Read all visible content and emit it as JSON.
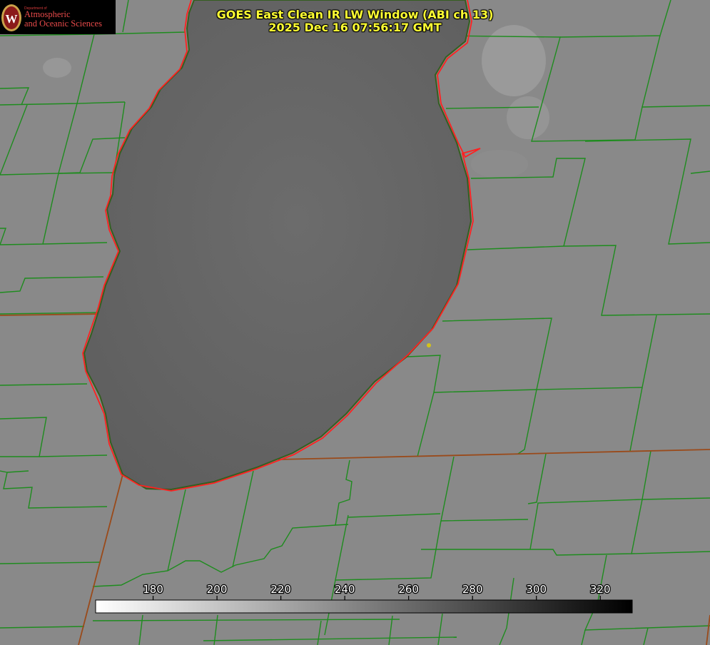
{
  "title": {
    "line1": "GOES East Clean IR LW Window (ABI ch 13)",
    "line2": "2025 Dec 16 07:56:17 GMT"
  },
  "logo": {
    "dept": "Department of",
    "line1": "Atmospheric",
    "line2": "and Oceanic Sciences",
    "emblem_letter": "W",
    "emblem_color": "#8b1a1a"
  },
  "colorbar": {
    "ticks": [
      {
        "label": "180",
        "value": 180
      },
      {
        "label": "200",
        "value": 200
      },
      {
        "label": "220",
        "value": 220
      },
      {
        "label": "240",
        "value": 240
      },
      {
        "label": "260",
        "value": 260
      },
      {
        "label": "280",
        "value": 280
      },
      {
        "label": "300",
        "value": 300
      },
      {
        "label": "320",
        "value": 320
      }
    ],
    "range": [
      162,
      330
    ],
    "gradient": [
      "#ffffff",
      "#000000"
    ]
  },
  "colors": {
    "county_lines": "#1e8c1e",
    "lake_outline": "#ff2020",
    "state_line": "#a04a1a",
    "land": "#8a8a8a",
    "lake": "#646464",
    "marker": "#d4c21a"
  }
}
